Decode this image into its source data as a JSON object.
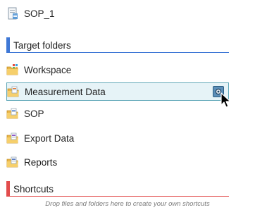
{
  "sop_item": {
    "label": "SOP_1",
    "icon": "sop-document-icon"
  },
  "target_folders": {
    "title": "Target folders",
    "accent_color": "#3f78d6",
    "items": [
      {
        "label": "Workspace",
        "icon": "workspace-folder-icon"
      },
      {
        "label": "Measurement Data",
        "icon": "measurement-folder-icon",
        "selected": true
      },
      {
        "label": "SOP",
        "icon": "sop-folder-icon"
      },
      {
        "label": "Export Data",
        "icon": "export-folder-icon"
      },
      {
        "label": "Reports",
        "icon": "reports-folder-icon"
      }
    ]
  },
  "shortcuts": {
    "title": "Shortcuts",
    "accent_color": "#e24c4c",
    "hint": "Drop files and folders here to create your own shortcuts"
  }
}
